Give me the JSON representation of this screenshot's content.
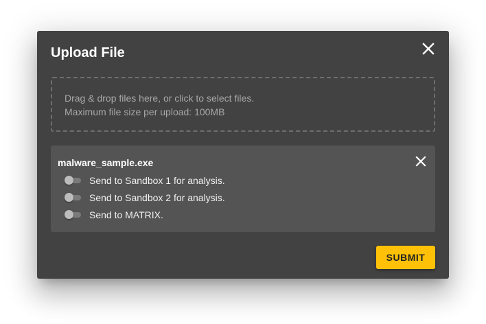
{
  "dialog": {
    "title": "Upload File",
    "close_icon": "close-icon"
  },
  "dropzone": {
    "line1": "Drag & drop files here, or click to select files.",
    "line2": "Maximum file size per upload: 100MB"
  },
  "file": {
    "name": "malware_sample.exe",
    "remove_icon": "close-icon",
    "options": [
      {
        "label": "Send to Sandbox 1 for analysis.",
        "enabled": false
      },
      {
        "label": "Send to Sandbox 2 for analysis.",
        "enabled": false
      },
      {
        "label": "Send to MATRIX.",
        "enabled": false
      }
    ]
  },
  "actions": {
    "submit_label": "SUBMIT"
  },
  "colors": {
    "dialog_bg": "#424242",
    "card_bg": "#545454",
    "accent": "#ffc107"
  }
}
